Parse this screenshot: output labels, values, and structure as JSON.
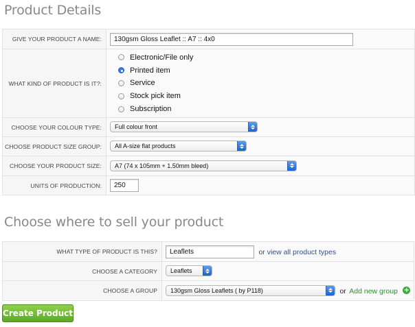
{
  "product_details": {
    "title": "Product Details",
    "name_label": "GIVE YOUR PRODUCT A NAME:",
    "name_value": "130gsm Gloss Leaflet  :: A7 :: 4x0",
    "kind_label": "WHAT KIND OF PRODUCT IS IT?:",
    "kind_options": [
      {
        "label": "Electronic/File only",
        "checked": false
      },
      {
        "label": "Printed item",
        "checked": true
      },
      {
        "label": "Service",
        "checked": false
      },
      {
        "label": "Stock pick item",
        "checked": false
      },
      {
        "label": "Subscription",
        "checked": false
      }
    ],
    "colour_label": "CHOOSE YOUR COLOUR TYPE:",
    "colour_value": "Full colour front",
    "size_group_label": "CHOOSE PRODUCT SIZE GROUP:",
    "size_group_value": "All A-size flat products",
    "size_label": "CHOOSE YOUR PRODUCT SIZE:",
    "size_value": "A7 (74 x 105mm + 1.50mm bleed)",
    "units_label": "UNITS OF PRODUCTION:",
    "units_value": "250"
  },
  "sell": {
    "title": "Choose where to sell your product",
    "type_label": "WHAT TYPE OF PRODUCT IS THIS?",
    "type_value": "Leaflets",
    "view_all_link": "or view all product types",
    "category_label": "CHOOSE A CATEGORY",
    "category_value": "Leaflets",
    "group_label": "CHOOSE A GROUP",
    "group_value": "130gsm Gloss Leaflets ( by P118)",
    "or_text": "or",
    "add_group_link": "Add new group"
  },
  "actions": {
    "create_label": "Create Product"
  },
  "colors": {
    "accent_green": "#6cb62e",
    "select_blue": "#2a6ad9",
    "heading_gray": "#888888"
  }
}
